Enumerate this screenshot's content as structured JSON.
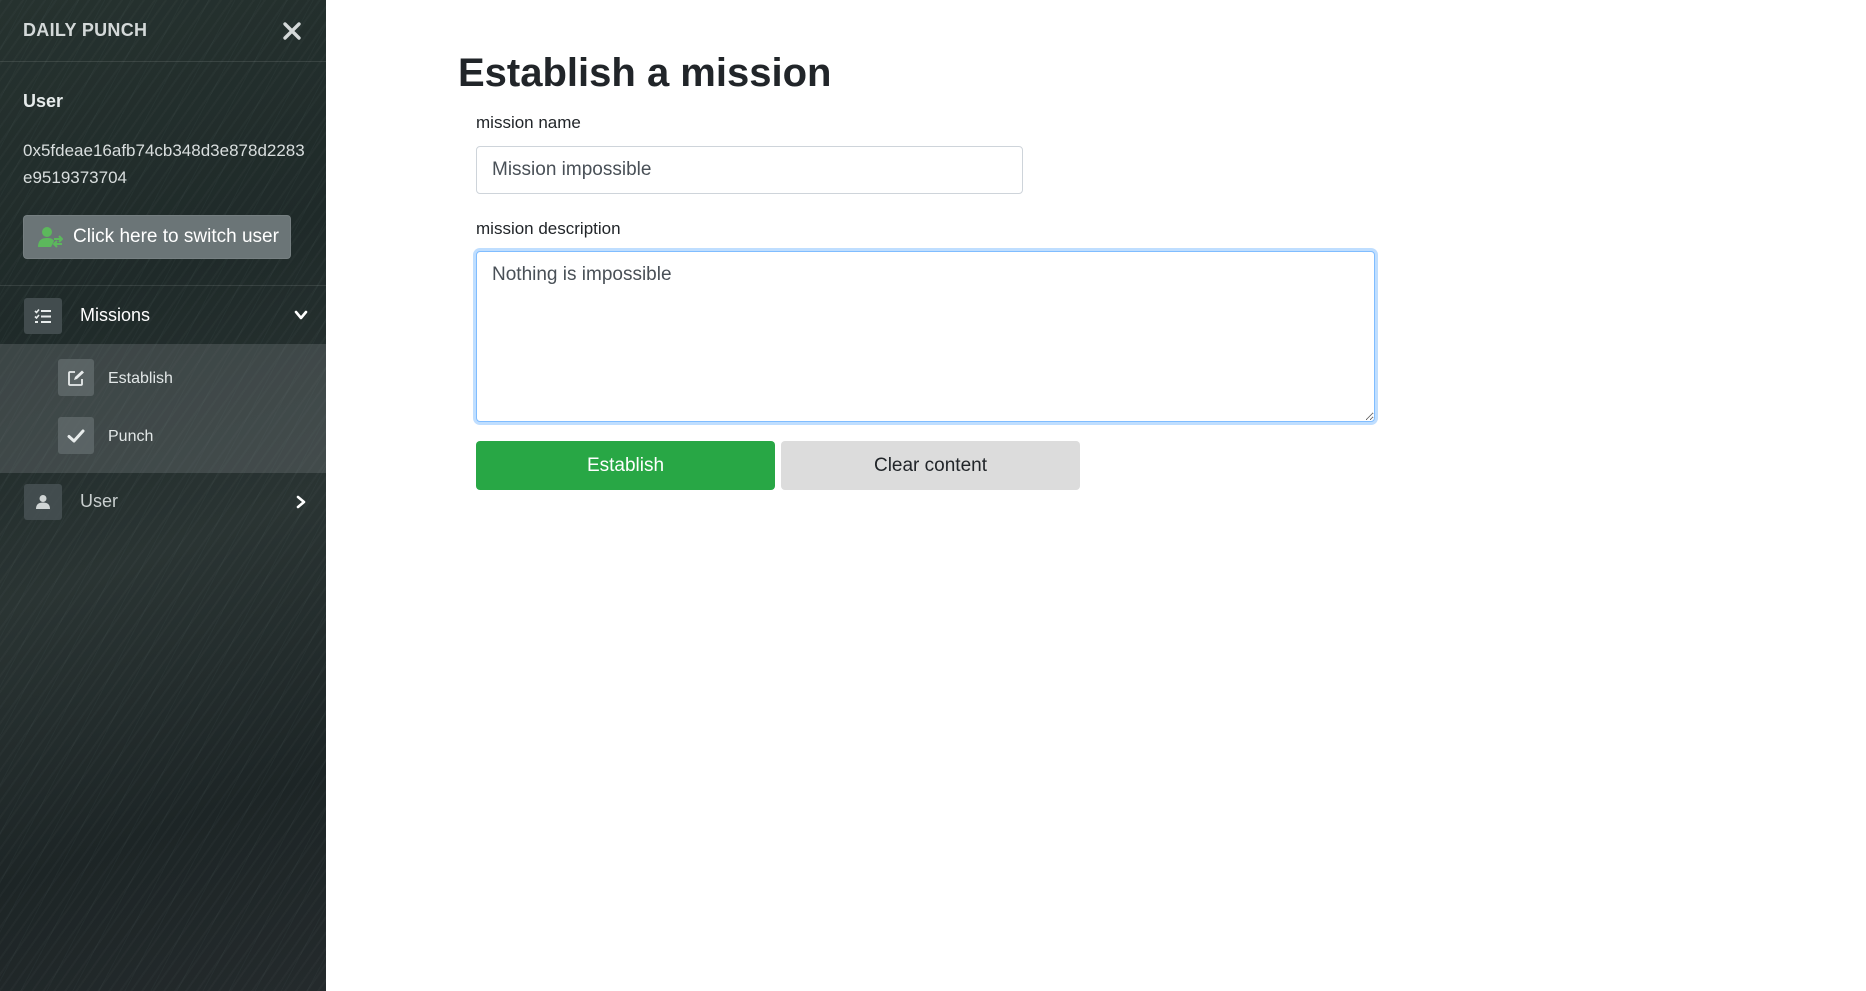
{
  "sidebar": {
    "title": "DAILY PUNCH",
    "user_heading": "User",
    "user_address": "0x5fdeae16afb74cb348d3e878d2283e9519373704",
    "switch_user_label": "Click here to switch user",
    "nav": {
      "missions_label": "Missions",
      "submenu": [
        {
          "label": "Establish",
          "icon": "edit-icon"
        },
        {
          "label": "Punch",
          "icon": "check-icon"
        }
      ],
      "user_label": "User"
    }
  },
  "main": {
    "title": "Establish a mission",
    "mission_name_label": "mission name",
    "mission_name_value": "Mission impossible",
    "mission_description_label": "mission description",
    "mission_description_value": "Nothing is impossible",
    "establish_button": "Establish",
    "clear_button": "Clear content"
  },
  "colors": {
    "primary_green": "#28a745",
    "focus_blue": "#80bdff",
    "switch_icon_green": "#5cb85c"
  }
}
